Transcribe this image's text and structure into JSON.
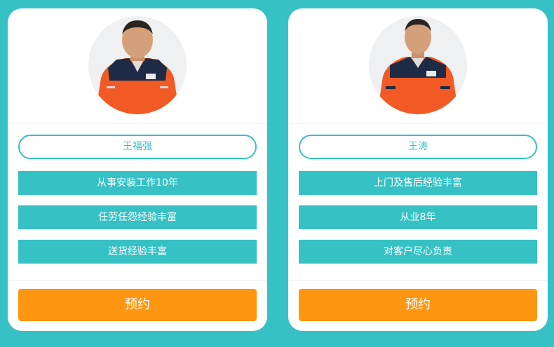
{
  "cards": [
    {
      "name": "王福强",
      "features": [
        "从事安装工作10年",
        "任劳任怨经验丰富",
        "送货经验丰富"
      ],
      "button_label": "预约"
    },
    {
      "name": "王涛",
      "features": [
        "上门及售后经验丰富",
        "从业8年",
        "对客户尽心负责"
      ],
      "button_label": "预约"
    }
  ],
  "colors": {
    "background": "#36c1c5",
    "accent": "#36c1c5",
    "button": "#ff9612",
    "uniform_orange": "#f15a24",
    "uniform_navy": "#1f2a44"
  }
}
